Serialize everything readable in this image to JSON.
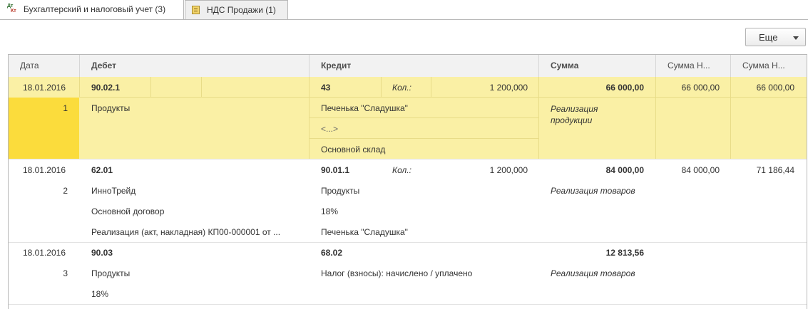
{
  "tabs": [
    {
      "label": "Бухгалтерский и налоговый учет (3)",
      "icon_d": "Дт",
      "icon_k": "Кт"
    },
    {
      "label": "НДС Продажи (1)"
    }
  ],
  "toolbar": {
    "more_label": "Еще"
  },
  "columns": {
    "date": "Дата",
    "debit": "Дебет",
    "credit": "Кредит",
    "sum": "Сумма",
    "sum_n1": "Сумма Н...",
    "sum_n2": "Сумма Н..."
  },
  "rows": [
    {
      "date": "18.01.2016",
      "num": "1",
      "debit_account": "90.02.1",
      "debit_sub1": "Продукты",
      "credit_account": "43",
      "qty_label": "Кол.:",
      "qty": "1 200,000",
      "credit_sub1": "Печенька \"Сладушка\"",
      "credit_sub2": "<...>",
      "credit_sub3": "Основной склад",
      "sum": "66 000,00",
      "content": "Реализация продукции",
      "sum_n1": "66 000,00",
      "sum_n2": "66 000,00"
    },
    {
      "date": "18.01.2016",
      "num": "2",
      "debit_account": "62.01",
      "debit_sub1": "ИнноТрейд",
      "debit_sub2": "Основной договор",
      "debit_sub3": "Реализация (акт, накладная) КП00-000001 от ...",
      "credit_account": "90.01.1",
      "qty_label": "Кол.:",
      "qty": "1 200,000",
      "credit_sub1": "Продукты",
      "credit_sub2": "18%",
      "credit_sub3": "Печенька \"Сладушка\"",
      "sum": "84 000,00",
      "content": "Реализация товаров",
      "sum_n1": "84 000,00",
      "sum_n2": "71 186,44"
    },
    {
      "date": "18.01.2016",
      "num": "3",
      "debit_account": "90.03",
      "debit_sub1": "Продукты",
      "debit_sub2": "18%",
      "credit_account": "68.02",
      "credit_sub1": "Налог (взносы): начислено / уплачено",
      "sum": "12 813,56",
      "content": "Реализация товаров"
    }
  ],
  "colors": {
    "selected_row": "#faf0a5",
    "selected_cell": "#fbdc3c",
    "header_bg": "#f2f2f2"
  }
}
